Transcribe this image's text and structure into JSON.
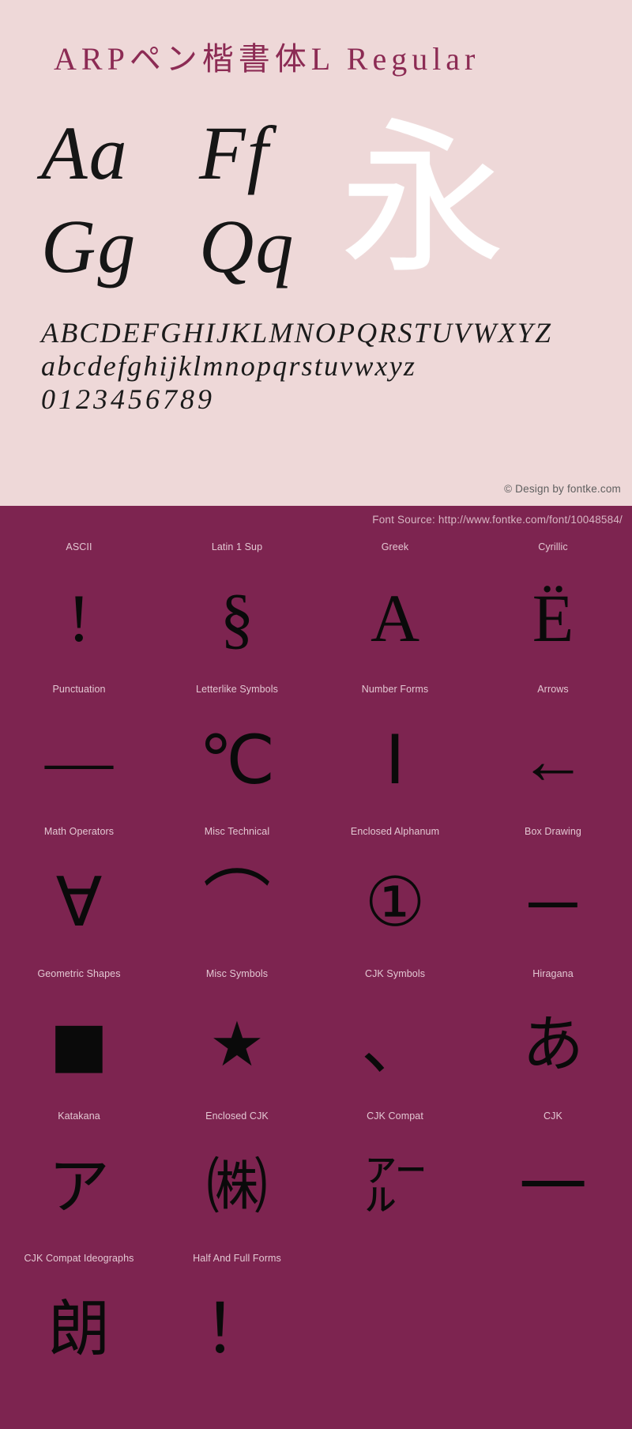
{
  "specimen": {
    "title": "ARPペン楷書体L Regular",
    "big_samples": [
      [
        "Aa",
        "Ff"
      ],
      [
        "Gg",
        "Qq"
      ]
    ],
    "kanji_sample": "永",
    "alphabet_uppercase": "ABCDEFGHIJKLMNOPQRSTUVWXYZ",
    "alphabet_lowercase": "abcdefghijklmnopqrstuvwxyz",
    "digits": "0123456789",
    "design_credit": "© Design by fontke.com",
    "background_color": "#eed8d8",
    "title_color": "#8c2b54"
  },
  "blocks_panel": {
    "font_source": "Font Source: http://www.fontke.com/font/10048584/",
    "background_color": "#7d2450",
    "label_color": "#e3c7d2",
    "blocks": [
      {
        "label": "ASCII",
        "glyph": "!"
      },
      {
        "label": "Latin 1 Sup",
        "glyph": "§"
      },
      {
        "label": "Greek",
        "glyph": "Α"
      },
      {
        "label": "Cyrillic",
        "glyph": "Ё"
      },
      {
        "label": "Punctuation",
        "glyph": "—"
      },
      {
        "label": "Letterlike Symbols",
        "glyph": "℃"
      },
      {
        "label": "Number Forms",
        "glyph": "Ⅰ"
      },
      {
        "label": "Arrows",
        "glyph": "←"
      },
      {
        "label": "Math Operators",
        "glyph": "∀"
      },
      {
        "label": "Misc Technical",
        "glyph": "⌒"
      },
      {
        "label": "Enclosed Alphanum",
        "glyph": "①"
      },
      {
        "label": "Box Drawing",
        "glyph": "─"
      },
      {
        "label": "Geometric Shapes",
        "glyph": "■"
      },
      {
        "label": "Misc Symbols",
        "glyph": "★"
      },
      {
        "label": "CJK Symbols",
        "glyph": "、"
      },
      {
        "label": "Hiragana",
        "glyph": "あ"
      },
      {
        "label": "Katakana",
        "glyph": "ア"
      },
      {
        "label": "Enclosed CJK",
        "glyph": "㈱"
      },
      {
        "label": "CJK Compat",
        "glyph": "㌃"
      },
      {
        "label": "CJK",
        "glyph": "一"
      },
      {
        "label": "CJK Compat Ideographs",
        "glyph": "朗"
      },
      {
        "label": "Half And Full Forms",
        "glyph": "！"
      }
    ]
  }
}
